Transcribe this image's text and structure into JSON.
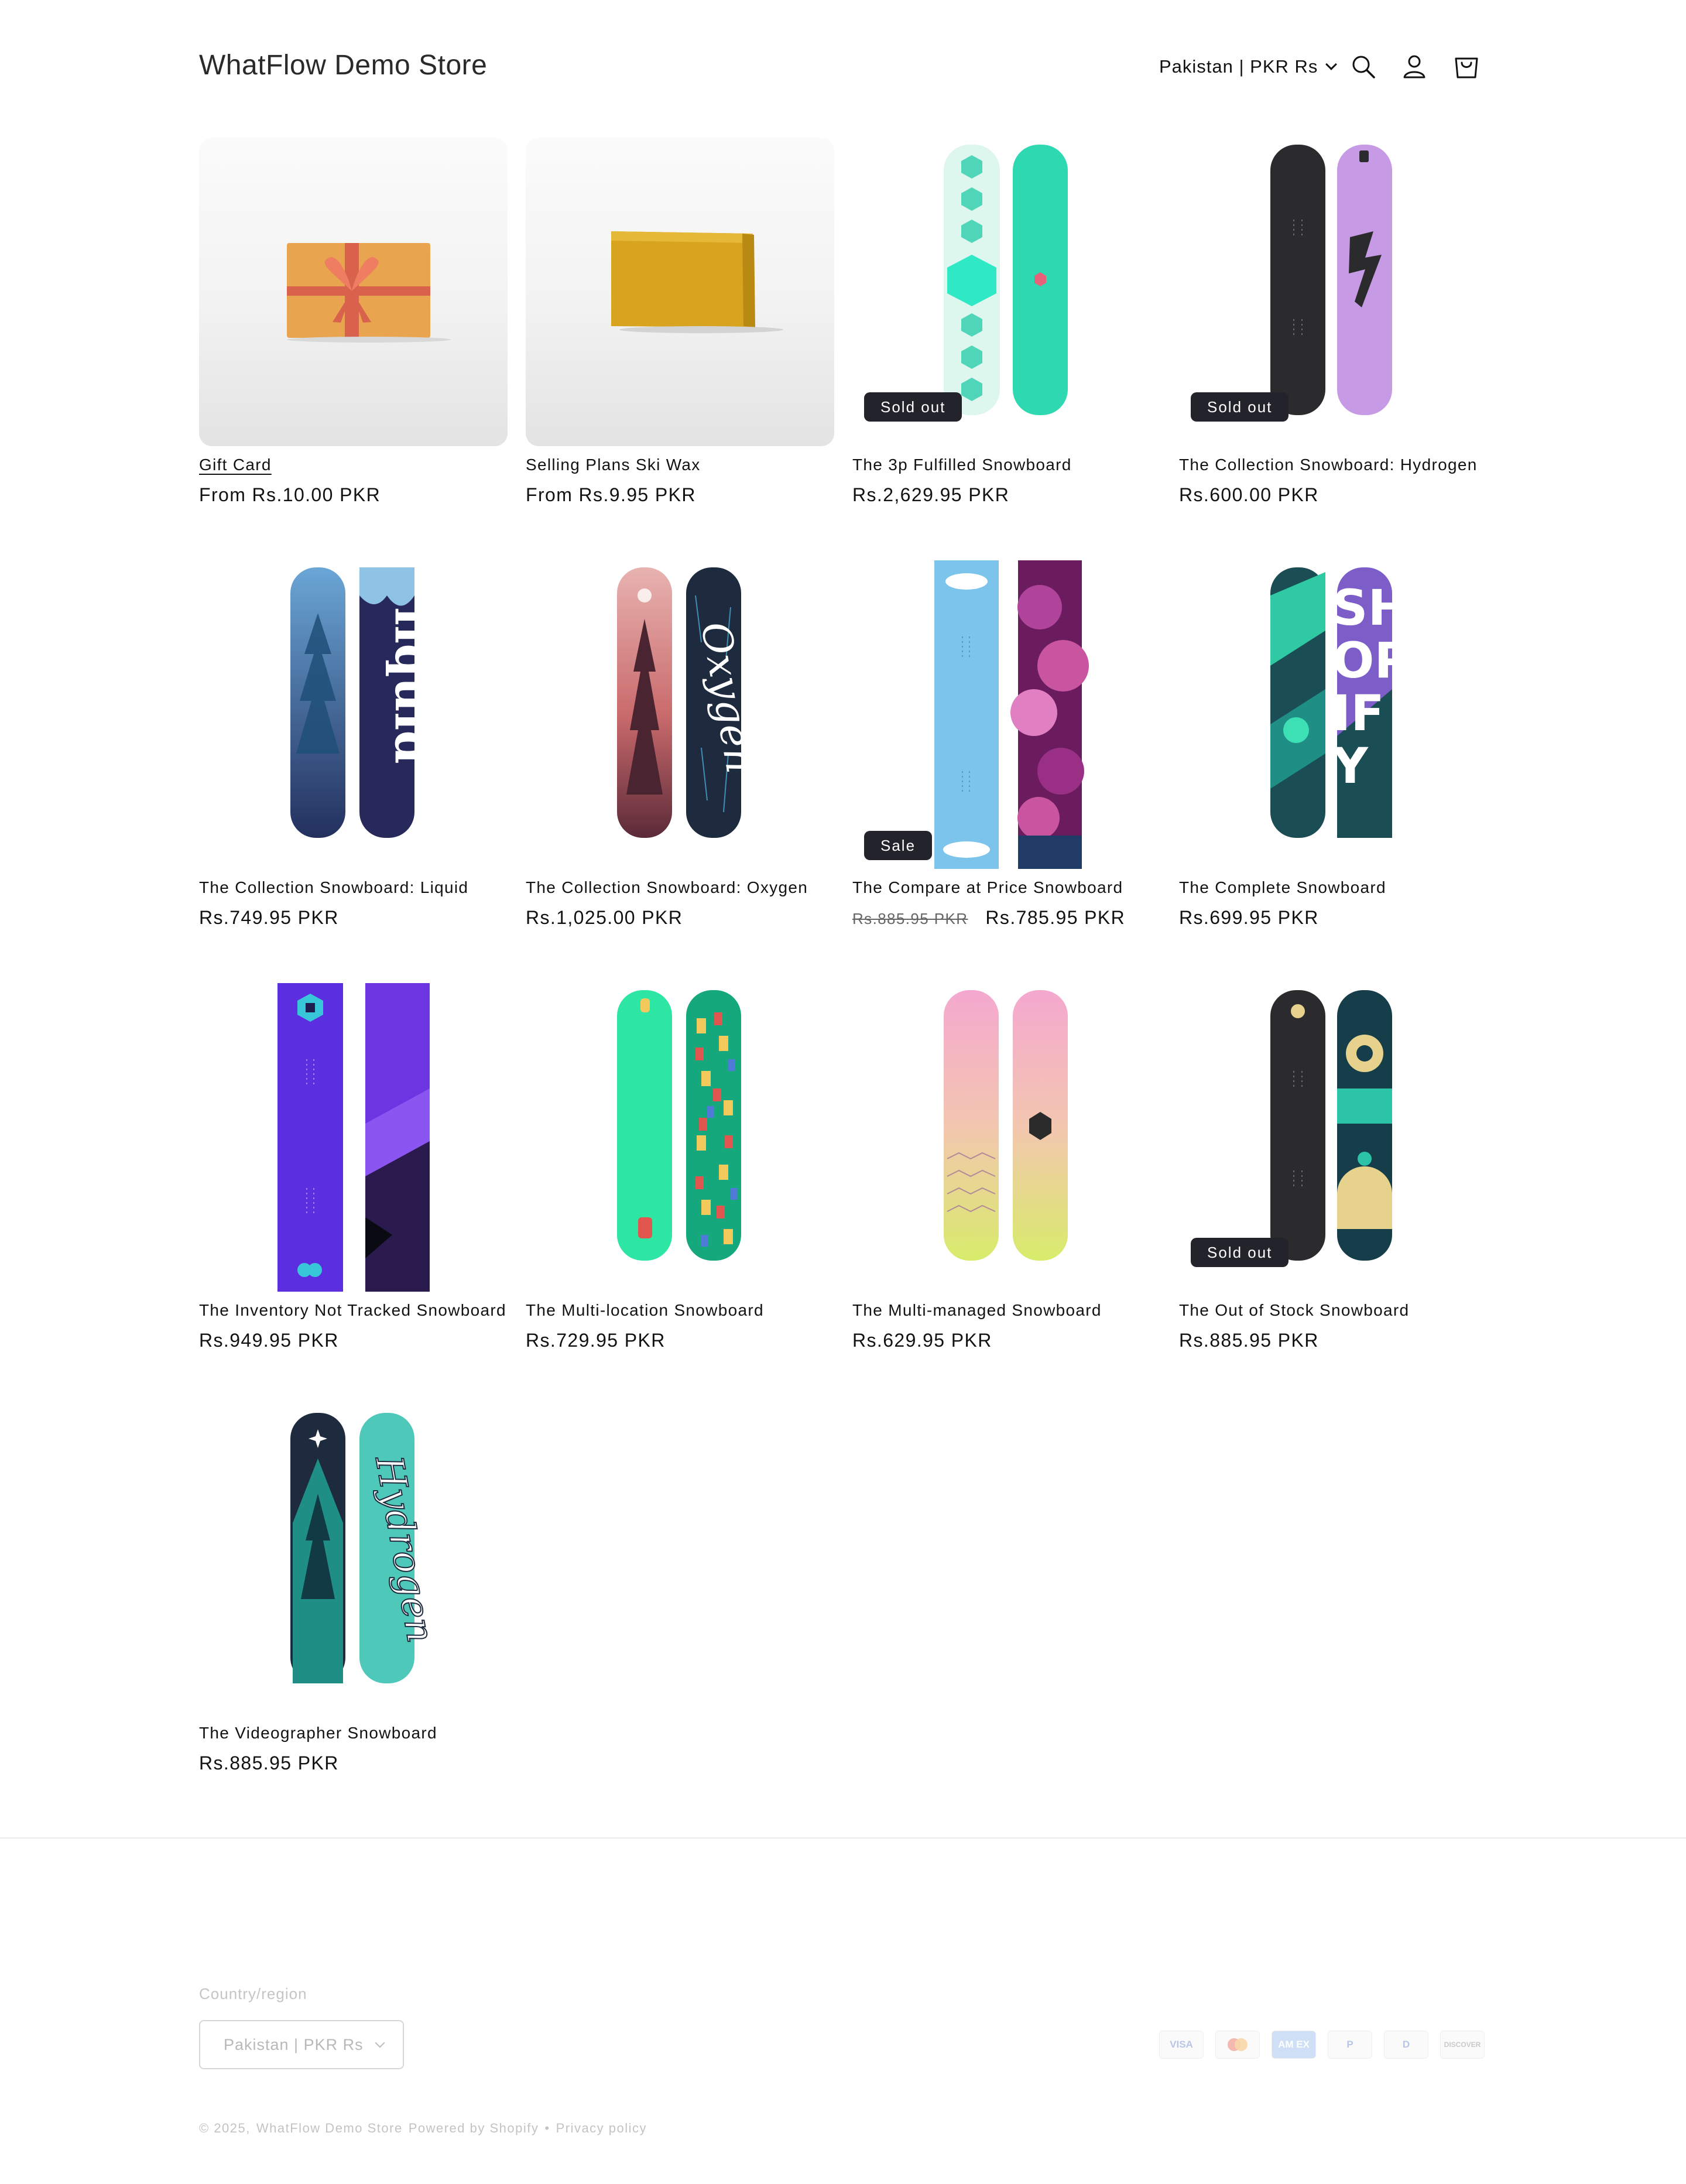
{
  "header": {
    "store_name": "WhatFlow Demo Store",
    "locale_selector": "Pakistan | PKR Rs",
    "icons": [
      "search-icon",
      "account-icon",
      "cart-icon"
    ]
  },
  "products": [
    {
      "title": "Gift Card",
      "price": "From Rs.10.00 PKR",
      "image": "gift-card-image"
    },
    {
      "title": "Selling Plans Ski Wax",
      "price": "From Rs.9.95 PKR",
      "image": "ski-wax-image"
    },
    {
      "title": "The 3p Fulfilled Snowboard",
      "price": "Rs.2,629.95 PKR",
      "badge": "Sold out"
    },
    {
      "title": "The Collection Snowboard: Hydrogen",
      "price": "Rs.600.00 PKR",
      "badge": "Sold out"
    },
    {
      "title": "The Collection Snowboard: Liquid",
      "price": "Rs.749.95 PKR",
      "art_text": "liquid"
    },
    {
      "title": "The Collection Snowboard: Oxygen",
      "price": "Rs.1,025.00 PKR",
      "art_text": "Oxygen"
    },
    {
      "title": "The Compare at Price Snowboard",
      "compare_price": "Rs.885.95 PKR",
      "price": "Rs.785.95 PKR",
      "badge": "Sale"
    },
    {
      "title": "The Complete Snowboard",
      "price": "Rs.699.95 PKR",
      "art_text": "SHOPIFY"
    },
    {
      "title": "The Inventory Not Tracked Snowboard",
      "price": "Rs.949.95 PKR"
    },
    {
      "title": "The Multi-location Snowboard",
      "price": "Rs.729.95 PKR"
    },
    {
      "title": "The Multi-managed Snowboard",
      "price": "Rs.629.95 PKR"
    },
    {
      "title": "The Out of Stock Snowboard",
      "price": "Rs.885.95 PKR",
      "badge": "Sold out"
    },
    {
      "title": "The Videographer Snowboard",
      "price": "Rs.885.95 PKR",
      "art_text": "Hydrogen"
    }
  ],
  "footer": {
    "country_label": "Country/region",
    "country_value": "Pakistan | PKR Rs",
    "payment_icons": [
      "VISA",
      "",
      "AM EX",
      "P",
      "D",
      "DISCOVER"
    ],
    "copyright": "© 2025,",
    "store_link": "WhatFlow Demo Store",
    "powered_by": "Powered by Shopify",
    "separator": "•",
    "privacy_link": "Privacy policy"
  },
  "colors": {
    "accent": "#121212",
    "badge_bg": "#23232b",
    "divider": "#ebebeb"
  }
}
